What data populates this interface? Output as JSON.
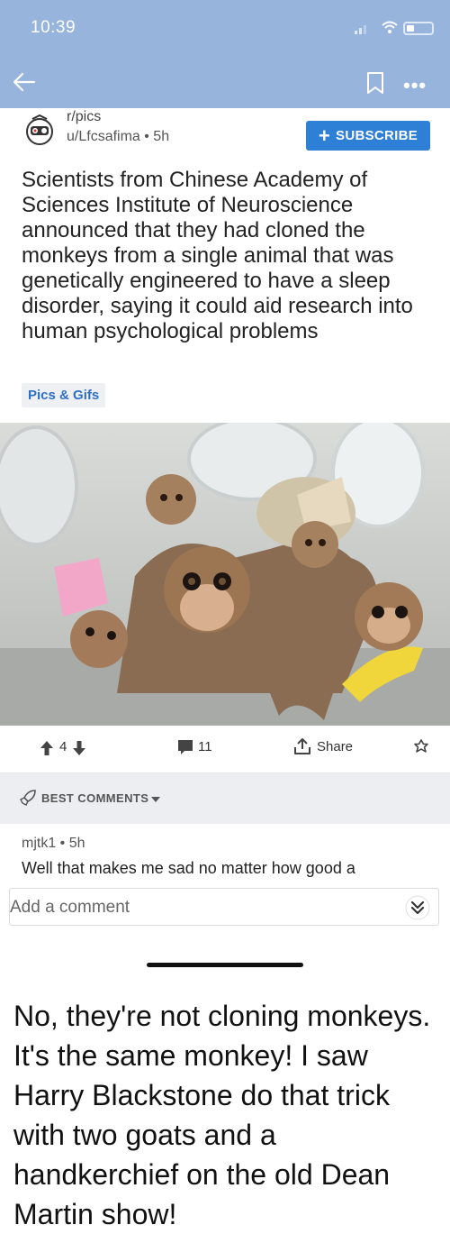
{
  "status_bar": {
    "time": "10:39"
  },
  "post": {
    "subreddit": "r/pics",
    "user_line": "u/Lfcsafima • 5h",
    "subscribe_label": "SUBSCRIBE",
    "title": "Scientists from Chinese Academy of Sciences Institute of Neuroscience announced that they had cloned the monkeys from a single animal that was genetically engineered to have a sleep disorder, saying it could aid research into human psychological problems",
    "flair": "Pics & Gifs",
    "score": "4",
    "comment_count": "11",
    "share_label": "Share"
  },
  "comments": {
    "sort_label": "BEST COMMENTS",
    "first_comment_user": "mjtk1 • 5h",
    "first_comment_text": "Well that makes me sad no matter how good a",
    "add_comment_placeholder": "Add a comment"
  },
  "caption": "No, they're not cloning monkeys. It's the same monkey! I saw Harry Blackstone do that trick with two goats and a handkerchief on the old Dean Martin show!",
  "colors": {
    "header_blue": "#97b4dd",
    "accent_blue": "#2e7fd6",
    "flair_text": "#2e6fc4"
  },
  "icons": [
    "back-arrow-icon",
    "bookmark-icon",
    "more-icon",
    "upvote-icon",
    "downvote-icon",
    "comment-icon",
    "share-icon",
    "award-icon",
    "rocket-icon",
    "chevron-down-icon",
    "double-chevron-down-icon"
  ]
}
